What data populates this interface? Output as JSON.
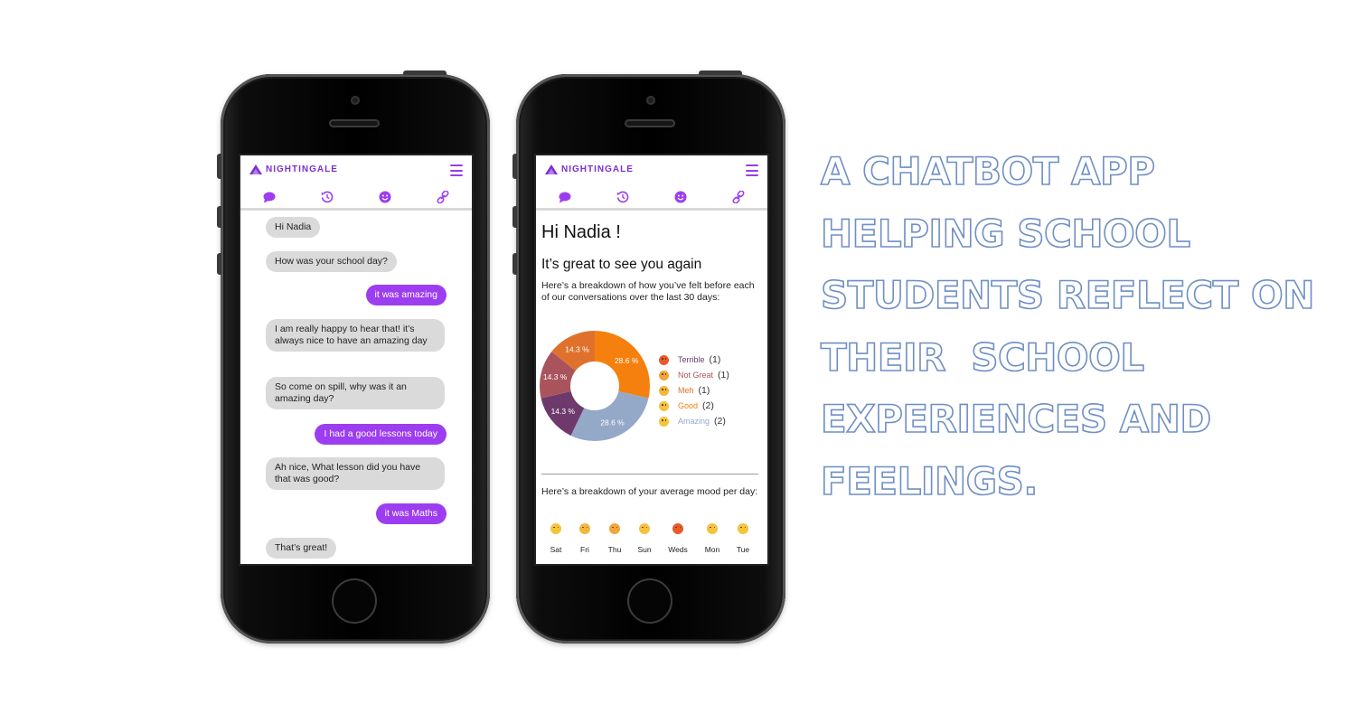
{
  "brand": {
    "name": "NIGHTINGALE",
    "accent": "#9d3df0",
    "logo_color": "#7b2fd0"
  },
  "tabs": [
    {
      "icon": "chat-bubble-icon"
    },
    {
      "icon": "history-icon"
    },
    {
      "icon": "smiley-icon"
    },
    {
      "icon": "link-icon"
    }
  ],
  "chat": {
    "messages": [
      {
        "from": "bot",
        "text": "Hi Nadia"
      },
      {
        "from": "bot",
        "text": "How was your school day?"
      },
      {
        "from": "user",
        "text": "it was amazing"
      },
      {
        "from": "bot",
        "text": "I am really happy to hear that! it’s always nice to have an amazing day"
      },
      {
        "from": "bot",
        "text": "So come on spill, why was it an amazing day?"
      },
      {
        "from": "user",
        "text": "I had a good lessons today"
      },
      {
        "from": "bot",
        "text": "Ah nice, What lesson did you have that was good?"
      },
      {
        "from": "user",
        "text": "it was Maths"
      },
      {
        "from": "bot",
        "text": "That’s great!"
      }
    ]
  },
  "dashboard": {
    "greeting": "Hi Nadia !",
    "subtitle": "It’s great to see you again",
    "breakdown_text": "Here’s a breakdown of how you’ve felt before each of our conversations over the last 30 days:",
    "daily_text": "Here’s a breakdown of your average mood per day:",
    "days": [
      {
        "day": "Sat",
        "mood": "Amazing"
      },
      {
        "day": "Fri",
        "mood": "Meh"
      },
      {
        "day": "Thu",
        "mood": "Not Great"
      },
      {
        "day": "Sun",
        "mood": "Good"
      },
      {
        "day": "Weds",
        "mood": "Terrible"
      },
      {
        "day": "Mon",
        "mood": "Good"
      },
      {
        "day": "Tue",
        "mood": "Amazing"
      }
    ]
  },
  "chart_data": {
    "type": "pie",
    "donut": true,
    "slices": [
      {
        "label": "Good",
        "count": 2,
        "percent": 28.6,
        "percent_label": "28.6 %",
        "color": "#f5800e"
      },
      {
        "label": "Amazing",
        "count": 2,
        "percent": 28.6,
        "percent_label": "28.6 %",
        "color": "#94a8c8"
      },
      {
        "label": "Terrible",
        "count": 1,
        "percent": 14.3,
        "percent_label": "14.3 %",
        "color": "#6e3a6b"
      },
      {
        "label": "Not Great",
        "count": 1,
        "percent": 14.3,
        "percent_label": "14.3 %",
        "color": "#a9545d"
      },
      {
        "label": "Meh",
        "count": 1,
        "percent": 14.3,
        "percent_label": "14.3 %",
        "color": "#e0712c"
      }
    ],
    "legend": [
      {
        "label": "Terrible",
        "count": "(1)",
        "color": "#6e3a6b",
        "emoji_color": "#e85a2a"
      },
      {
        "label": "Not Great",
        "count": "(1)",
        "color": "#a9545d",
        "emoji_color": "#f2a53a"
      },
      {
        "label": "Meh",
        "count": "(1)",
        "color": "#e0712c",
        "emoji_color": "#f3b63c"
      },
      {
        "label": "Good",
        "count": "(2)",
        "color": "#f5800e",
        "emoji_color": "#f6c13f"
      },
      {
        "label": "Amazing",
        "count": "(2)",
        "color": "#94a8c8",
        "emoji_color": "#f4c43a"
      }
    ],
    "legend_placement": "right"
  },
  "mood_colors": {
    "Terrible": "#e85a2a",
    "Not Great": "#f2a53a",
    "Meh": "#f3b63c",
    "Good": "#f6c13f",
    "Amazing": "#f4c43a"
  },
  "headline": {
    "lines": [
      "A CHATBOT APP",
      "HELPING SCHOOL",
      "STUDENTS REFLECT ON",
      "THEIR  SCHOOL",
      "EXPERIENCES AND",
      "FEELINGS."
    ],
    "outline_color": "#6f8fc4"
  }
}
